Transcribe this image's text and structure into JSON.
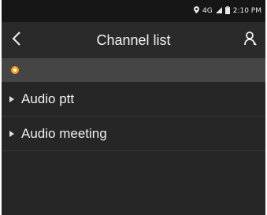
{
  "status_bar": {
    "location_icon": "location-pin-icon",
    "network": "4G",
    "signal_icon": "signal-icon",
    "battery_icon": "battery-icon",
    "time": "2:10 PM"
  },
  "app_bar": {
    "back_icon": "chevron-left-icon",
    "title": "Channel list",
    "user_icon": "user-icon"
  },
  "filter_bar": {
    "indicator_icon": "status-dot-icon",
    "indicator_color": "#f3a21f"
  },
  "channels": [
    {
      "label": "Audio ptt"
    },
    {
      "label": "Audio meeting"
    }
  ],
  "colors": {
    "background": "#262626",
    "status_bar": "#161616",
    "filter_bar": "#454545",
    "text": "#f0f0f0"
  }
}
